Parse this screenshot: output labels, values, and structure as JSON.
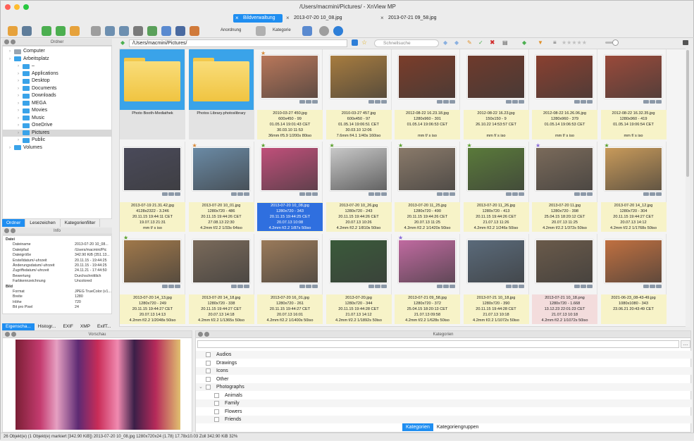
{
  "window": {
    "title": "/Users/macmini/Pictures/ - XnView MP"
  },
  "tabs": [
    {
      "label": "Bildverwaltung",
      "active": true
    },
    {
      "label": "2013-07-20 10_08.jpg",
      "active": false
    },
    {
      "label": "2013-07-21 09_58.jpg",
      "active": false
    }
  ],
  "toolbar": {
    "arrange_label": "Anordnung",
    "category_label": "Kategorie"
  },
  "folders_panel": {
    "title": "Ordner"
  },
  "tree": [
    {
      "label": "Computer",
      "level": 0
    },
    {
      "label": "Arbeitsplatz",
      "level": 0
    },
    {
      "label": "–",
      "level": 1
    },
    {
      "label": "Applications",
      "level": 1
    },
    {
      "label": "Desktop",
      "level": 1
    },
    {
      "label": "Documents",
      "level": 1
    },
    {
      "label": "Downloads",
      "level": 1
    },
    {
      "label": "MEGA",
      "level": 1
    },
    {
      "label": "Movies",
      "level": 1
    },
    {
      "label": "Music",
      "level": 1
    },
    {
      "label": "OneDrive",
      "level": 1
    },
    {
      "label": "Pictures",
      "level": 1,
      "selected": true
    },
    {
      "label": "Public",
      "level": 1
    },
    {
      "label": "Volumes",
      "level": 0
    }
  ],
  "panel_tabs": [
    "Ordner",
    "Lesezeichen",
    "Kategorienfilter"
  ],
  "info_panel": {
    "title": "Info"
  },
  "info": [
    {
      "key": "Datei",
      "value": "",
      "group": true
    },
    {
      "key": "Dateiname",
      "value": "2013-07-20 10_08..."
    },
    {
      "key": "Dateipfad",
      "value": "/Users/macmini/Pic"
    },
    {
      "key": "Dateigröße",
      "value": "342.90 KiB (351.13..."
    },
    {
      "key": "Erstelldatum/-uhrzeit",
      "value": "20.11.15 - 19:44:25"
    },
    {
      "key": "Änderungsdatum/-uhrzeit",
      "value": "20.11.15 - 19:44:25"
    },
    {
      "key": "Zugriffsdatum/-uhrzeit",
      "value": "24.11.21 - 17:44:50"
    },
    {
      "key": "Bewertung",
      "value": "Durchschnittlich"
    },
    {
      "key": "Farbkennzeichnung",
      "value": "Uncolored"
    },
    {
      "key": "Bild",
      "value": "",
      "group": true
    },
    {
      "key": "Format",
      "value": "JPEG TrueColor (v1..."
    },
    {
      "key": "Breite",
      "value": "1280"
    },
    {
      "key": "Höhe",
      "value": "720"
    },
    {
      "key": "Bit pro Pixel",
      "value": "24"
    }
  ],
  "bottom_tabs": [
    "Eigenscha...",
    "Histogr...",
    "EXIF",
    "XMP",
    "ExifT..."
  ],
  "preview_panel": {
    "title": "Vorschau"
  },
  "categories_panel": {
    "title": "Kategorien"
  },
  "path": "/Users/macmini/Pictures/",
  "quick_search_placeholder": "Schnellsuche",
  "thumbnails": [
    {
      "type": "folder",
      "lines": [
        "Photo Booth-Mediathek",
        "",
        "",
        ""
      ]
    },
    {
      "type": "folder",
      "lines": [
        "Photos Library.photoslibrary",
        "",
        "",
        ""
      ]
    },
    {
      "type": "image",
      "star": "#d88a3a",
      "color": "#b9775a",
      "lines": [
        "2010-03-27 450.jpg",
        "600x450 - 99",
        "01.05.14 19:01:43 CET",
        "30.03.10 11:53",
        "36mm f/5.9 1/200s 80iso"
      ]
    },
    {
      "type": "image",
      "star": "",
      "color": "#a77c3f",
      "lines": [
        "2010-03-27 457.jpg",
        "600x450 - 97",
        "01.05.14 19:06:51 CET",
        "30.03.10 12:06",
        "7.6mm f/4.1 1/40s 160iso"
      ]
    },
    {
      "type": "image",
      "star": "",
      "color": "#7b3d2a",
      "lines": [
        "2012-08-22 16.23.18.jpg",
        "1280x960 - 301",
        "01.05.14 19:06:53 CET",
        "",
        "mm f/ s iso"
      ]
    },
    {
      "type": "image",
      "star": "",
      "color": "#6f3a2c",
      "lines": [
        "2012-08-22 16.23.jpg",
        "150x150 - 9",
        "26.10.22 14:53:57 CET",
        "",
        "mm f/ s iso"
      ]
    },
    {
      "type": "image",
      "star": "",
      "color": "#8a4030",
      "lines": [
        "2012-08-22 16.26.06.jpg",
        "1280x960 - 379",
        "01.05.14 19:06:53 CET",
        "",
        "mm f/ s iso"
      ]
    },
    {
      "type": "image",
      "star": "",
      "color": "#9a4a3a",
      "lines": [
        "2012-08-22 16.32.35.jpg",
        "1280x960 - 419",
        "01.05.14 19:06:54 CET",
        "",
        "mm f/ s iso"
      ]
    },
    {
      "type": "image",
      "star": "",
      "color": "#4a4a5a",
      "lines": [
        "2013-07-19 21.31.42.jpg",
        "4128x2322 - 3.246",
        "20.11.15 19:44:11 CET",
        "19.07.13 21:31",
        "mm f/ s iso"
      ]
    },
    {
      "type": "image",
      "star": "#d88a3a",
      "color": "#6a8aa5",
      "lines": [
        "2013-07-20 10_01.jpg",
        "1280x720 - 486",
        "20.11.15 19:44:26 CET",
        "27.08.13 22:30",
        "4.2mm f/2.2 1/33s 64iso"
      ]
    },
    {
      "type": "image",
      "star": "#5aa02c",
      "color": "#c04f7a",
      "selected": true,
      "lines": [
        "2013-07-20 10_08.jpg",
        "1280x720 - 343",
        "20.11.15 19:44:25 CET",
        "20.07.13 10:08",
        "4.2mm f/2.2 1/87s 50iso"
      ]
    },
    {
      "type": "image",
      "star": "#5aa02c",
      "color": "#c8c8c8",
      "lines": [
        "2013-07-20 10_26.jpg",
        "1280x720 - 243",
        "20.11.15 19:44:26 CET",
        "20.07.13 10:26",
        "4.2mm f/2.2 1/810s 50iso"
      ]
    },
    {
      "type": "image",
      "star": "#5aa02c",
      "color": "#8a7a6a",
      "lines": [
        "2013-07-20 11_25.jpg",
        "1280x720 - 490",
        "20.11.15 19:44:26 CET",
        "20.07.13 11:25",
        "4.2mm f/2.2 1/1420s 50iso"
      ]
    },
    {
      "type": "image",
      "star": "#5aa02c",
      "color": "#5a7a3a",
      "lines": [
        "2013-07-20 11_26.jpg",
        "1280x720 - 413",
        "20.11.15 19:44:26 CET",
        "21.07.13 11:26",
        "4.2mm f/2.2 1/246s 50iso"
      ]
    },
    {
      "type": "image",
      "star": "#8a6ad8",
      "color": "#7a6a5a",
      "lines": [
        "2013-07-20 11.jpg",
        "1280x720 - 398",
        "25.04.15 18:20:12 CET",
        "20.07.13 11:25",
        "4.2mm f/2.2 1/372s 50iso"
      ]
    },
    {
      "type": "image",
      "star": "#5aa02c",
      "color": "#c89a5a",
      "lines": [
        "2013-07-20 14_12.jpg",
        "1280x720 - 304",
        "20.11.15 19:44:27 CET",
        "20.07.13 14:12",
        "4.2mm f/2.2 1/1768s 50iso"
      ]
    },
    {
      "type": "image",
      "star": "#5aa02c",
      "color": "#a0784a",
      "lines": [
        "2013-07-20 14_13.jpg",
        "1280x720 - 249",
        "20.11.15 19:44:27 CET",
        "20.07.13 14:13",
        "4.2mm f/2.2 1/2048s 50iso"
      ]
    },
    {
      "type": "image",
      "star": "",
      "color": "#7a6a5a",
      "lines": [
        "2013-07-20 14_18.jpg",
        "1280x720 - 338",
        "20.11.15 19:44:27 CET",
        "20.07.13 14:18",
        "4.2mm f/2.2 1/1365s 50iso"
      ]
    },
    {
      "type": "image",
      "star": "",
      "color": "#9a7a5a",
      "lines": [
        "2013-07-20 16_01.jpg",
        "1280x720 - 261",
        "20.11.15 19:44:27 CET",
        "20.07.13 16:01",
        "4.2mm f/2.2 1/1400s 50iso"
      ]
    },
    {
      "type": "image",
      "star": "",
      "color": "#3a5a3a",
      "lines": [
        "2013-07-20.jpg",
        "1280x720 - 344",
        "20.11.15 19:44:28 CET",
        "21.07.13 14:12",
        "4.2mm f/2.2 1/1892s 50iso"
      ]
    },
    {
      "type": "image",
      "star": "#8a6ad8",
      "color": "#c06aa0",
      "lines": [
        "2013-07-21 09_58.jpg",
        "1280x720 - 372",
        "25.04.15 18:20:13 CET",
        "21.07.13 09:58",
        "4.2mm f/2.2 1/628s 50iso"
      ]
    },
    {
      "type": "image",
      "star": "",
      "color": "#5a6a7a",
      "lines": [
        "2013-07-21 10_18.jpg",
        "1280x720 - 390",
        "20.11.15 19:44:28 CET",
        "21.07.13 10:18",
        "4.2mm f/2.2 1/1072s 50iso"
      ]
    },
    {
      "type": "image",
      "star": "",
      "color": "#6a5a4a",
      "pink": true,
      "lines": [
        "2013-07-21 10_18.png",
        "1280x720 - 1.668",
        "13.12.23 22:01:23 CET",
        "21.07.13 10:18",
        "4.2mm f/2.2 1/1072s 50iso"
      ]
    },
    {
      "type": "image",
      "star": "",
      "color": "#c07040",
      "lines": [
        "2021-06-23_08-43-49.jpg",
        "1080x1080 - 343",
        "23.06.21 20:43:49 CET",
        "",
        ""
      ]
    }
  ],
  "categories": [
    {
      "label": "Audios",
      "level": 0
    },
    {
      "label": "Drawings",
      "level": 0
    },
    {
      "label": "Icons",
      "level": 0
    },
    {
      "label": "Other",
      "level": 0
    },
    {
      "label": "Photographs",
      "level": 0,
      "expanded": true
    },
    {
      "label": "Animals",
      "level": 1
    },
    {
      "label": "Family",
      "level": 1
    },
    {
      "label": "Flowers",
      "level": 1
    },
    {
      "label": "Friends",
      "level": 1
    }
  ],
  "category_tabs": [
    "Kategorien",
    "Kategoriengruppen"
  ],
  "status": "26 Objekt(e) (1 Objekt(e) markiert [342.90 KiB])   2013-07-20 10_08.jpg   1280x720x24 (1.78)   17.78x10.03 Zoll   342.90 KiB   32%"
}
